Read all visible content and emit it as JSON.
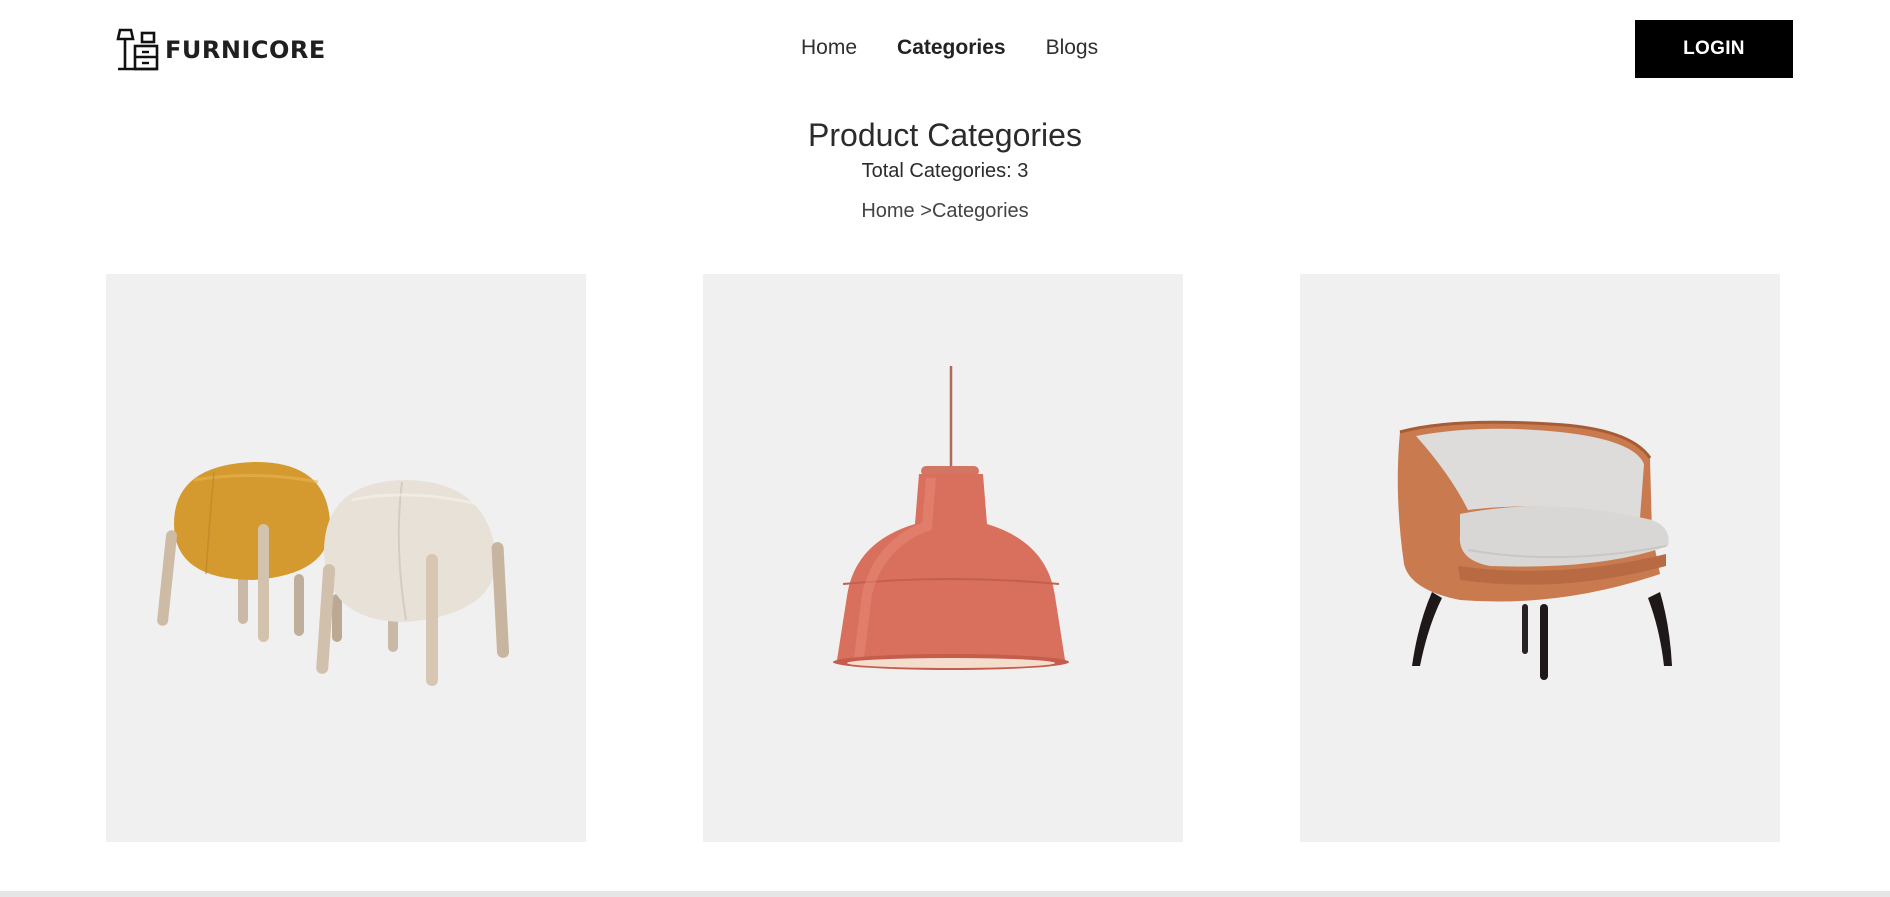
{
  "brand": {
    "name": "FURNICORE",
    "icon": "lamp-cabinet-icon"
  },
  "nav": {
    "items": [
      {
        "label": "Home",
        "active": false
      },
      {
        "label": "Categories",
        "active": true
      },
      {
        "label": "Blogs",
        "active": false
      }
    ]
  },
  "header": {
    "login_label": "LOGIN"
  },
  "page": {
    "title": "Product Categories",
    "total": "Total Categories: 3",
    "breadcrumb": {
      "home": "Home",
      "separator": " >",
      "current": "Categories"
    }
  },
  "categories": [
    {
      "image": "poufs-image"
    },
    {
      "image": "pendant-lamp-image"
    },
    {
      "image": "armchair-image"
    }
  ],
  "colors": {
    "card_bg": "#f0f0f0",
    "button_bg": "#000000",
    "accent_lamp": "#d9705e",
    "accent_chair": "#c97b4f",
    "accent_pouf": "#d9a032"
  }
}
